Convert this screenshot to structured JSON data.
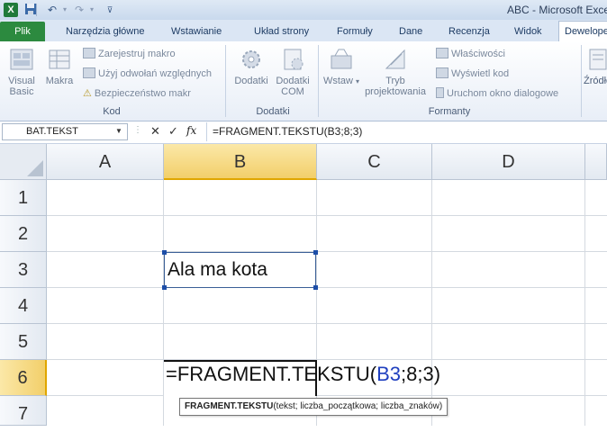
{
  "titlebar": {
    "app_icon": "excel-icon",
    "quick_access": [
      "save-icon",
      "undo-icon",
      "redo-icon",
      "customize-icon"
    ],
    "title": "ABC - Microsoft Excel"
  },
  "tabs": [
    "Plik",
    "Narzędzia główne",
    "Wstawianie",
    "Układ strony",
    "Formuły",
    "Dane",
    "Recenzja",
    "Widok",
    "Deweloper"
  ],
  "active_tab": "Deweloper",
  "ribbon": {
    "kod": {
      "label": "Kod",
      "visual_basic": "Visual Basic",
      "makra": "Makra",
      "zarejestruj": "Zarejestruj makro",
      "odwolania": "Użyj odwołań względnych",
      "bezpieczenstwo": "Bezpieczeństwo makr"
    },
    "dodatki": {
      "label": "Dodatki",
      "dodatki": "Dodatki",
      "dodatki_com": "Dodatki COM"
    },
    "formanty": {
      "label": "Formanty",
      "wstaw": "Wstaw",
      "tryb": "Tryb projektowania",
      "wlasciwosci": "Właściwości",
      "wyswietl_kod": "Wyświetl kod",
      "uruchom": "Uruchom okno dialogowe"
    },
    "zrodlo": "Źródło"
  },
  "formula_bar": {
    "name_box": "BAT.TEKST",
    "cancel": "✕",
    "enter": "✓",
    "fx": "fx",
    "formula": "=FRAGMENT.TEKSTU(B3;8;3)"
  },
  "grid": {
    "columns": [
      "A",
      "B",
      "C",
      "D"
    ],
    "rows": [
      "1",
      "2",
      "3",
      "4",
      "5",
      "6",
      "7"
    ],
    "selected_column": "B",
    "selected_row": "6",
    "b3": "Ala ma kota",
    "b6": {
      "prefix": "=FRAGMENT.TEKSTU(",
      "ref": "B3",
      "suffix": ";8;3)",
      "ref_color": "#1f3fbf"
    }
  },
  "tooltip": {
    "fn": "FRAGMENT.TEKSTU",
    "args": "(tekst; liczba_początkowa; liczba_znaków)"
  }
}
